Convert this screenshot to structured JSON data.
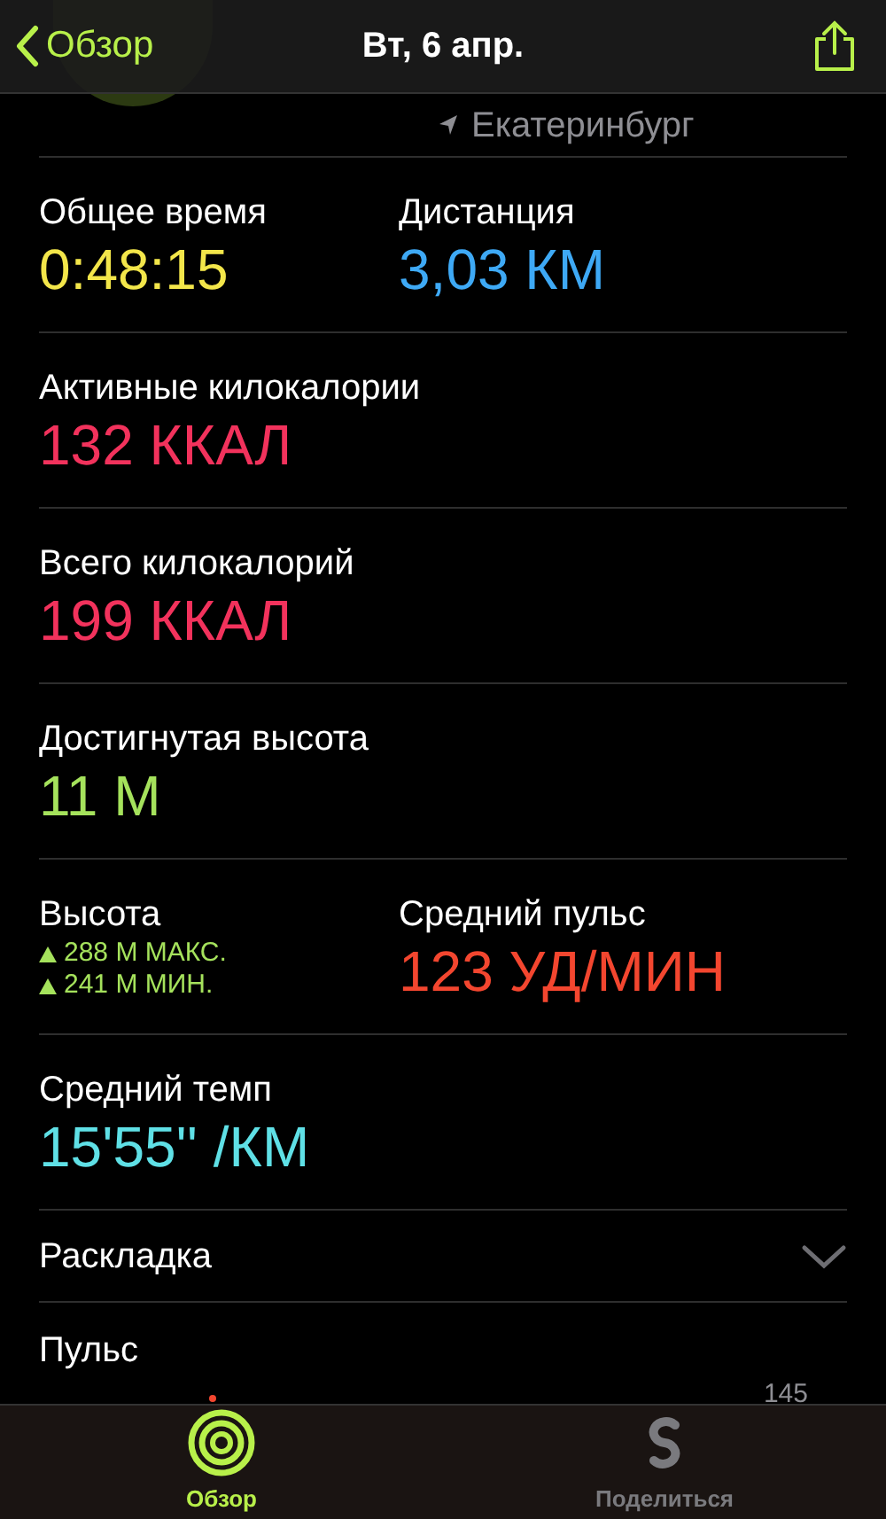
{
  "nav": {
    "back_label": "Обзор",
    "title": "Вт, 6 апр."
  },
  "location": "Екатеринбург",
  "metric_rows": [
    {
      "cells": [
        {
          "kind": "value",
          "label": "Общее время",
          "value": "0:48:15",
          "color": "#f3e64a"
        },
        {
          "kind": "value",
          "label": "Дистанция",
          "value": "3,03 КМ",
          "color": "#3ea9f5"
        }
      ]
    },
    {
      "cells": [
        {
          "kind": "value",
          "label": "Активные килокалории",
          "value": "132 ККАЛ",
          "color": "#f2325c"
        }
      ]
    },
    {
      "cells": [
        {
          "kind": "value",
          "label": "Всего килокалорий",
          "value": "199 ККАЛ",
          "color": "#f2325c"
        }
      ]
    },
    {
      "cells": [
        {
          "kind": "value",
          "label": "Достигнутая высота",
          "value": "11 М",
          "color": "#a5e25c"
        }
      ]
    },
    {
      "cells": [
        {
          "kind": "elevation",
          "label": "Высота",
          "lines": [
            "288 М МАКС.",
            "241 М МИН."
          ],
          "color": "#a5e25c"
        },
        {
          "kind": "value",
          "label": "Средний пульс",
          "value": "123 УД/МИН",
          "color": "#f3462f"
        }
      ]
    },
    {
      "cells": [
        {
          "kind": "value",
          "label": "Средний темп",
          "value": "15'55'' /КМ",
          "color": "#5fe0e6"
        }
      ]
    }
  ],
  "splits": {
    "label": "Раскладка",
    "expanded": false
  },
  "heart_rate": {
    "title": "Пульс",
    "axis_label": "145"
  },
  "tabs": [
    {
      "label": "Обзор",
      "selected": true
    },
    {
      "label": "Поделиться",
      "selected": false
    }
  ]
}
